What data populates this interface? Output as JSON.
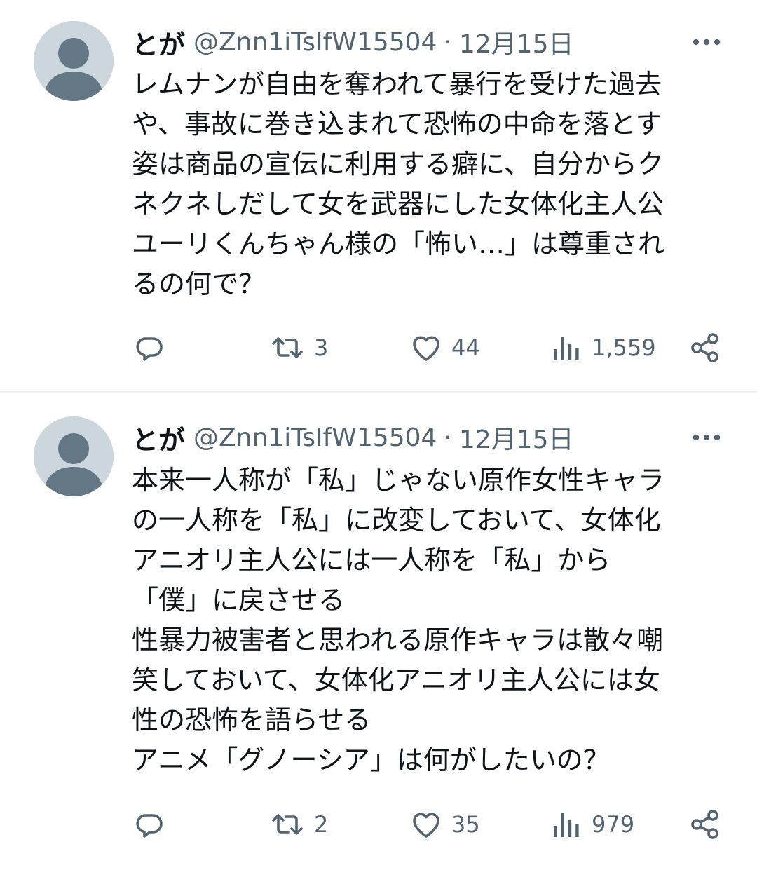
{
  "tweets": [
    {
      "name": "とが",
      "handle": "@Znn1iTsIfW15504",
      "dot": "·",
      "time": "12月15日",
      "text": "レムナンが自由を奪われて暴行を受けた過去\nや、事故に巻き込まれて恐怖の中命を落とす\n姿は商品の宣伝に利用する癖に、自分からク\nネクネしだして女を武器にした女体化主人公\nユーリくんちゃん様の「怖い…」は尊重され\nるの何で？",
      "replies": "",
      "retweets": "3",
      "likes": "44",
      "views": "1,559"
    },
    {
      "name": "とが",
      "handle": "@Znn1iTsIfW15504",
      "dot": "·",
      "time": "12月15日",
      "text": "本来一人称が「私」じゃない原作女性キャラ\nの一人称を「私」に改変しておいて、女体化\nアニオリ主人公には一人称を「私」から\n「僕」に戻させる\n性暴力被害者と思われる原作キャラは散々嘲\n笑しておいて、女体化アニオリ主人公には女\n性の恐怖を語らせる\nアニメ「グノーシア」は何がしたいの？",
      "replies": "",
      "retweets": "2",
      "likes": "35",
      "views": "979"
    }
  ],
  "icons": {
    "avatar": "default-avatar",
    "more": "more-horizontal-icon",
    "reply": "reply-icon",
    "retweet": "retweet-icon",
    "like": "heart-icon",
    "views": "views-icon",
    "share": "share-icon"
  },
  "colors": {
    "text_primary": "#0f1419",
    "text_secondary": "#536471",
    "avatar_bg": "#ccd6dd",
    "avatar_fg": "#647785",
    "divider": "#eff3f4"
  }
}
